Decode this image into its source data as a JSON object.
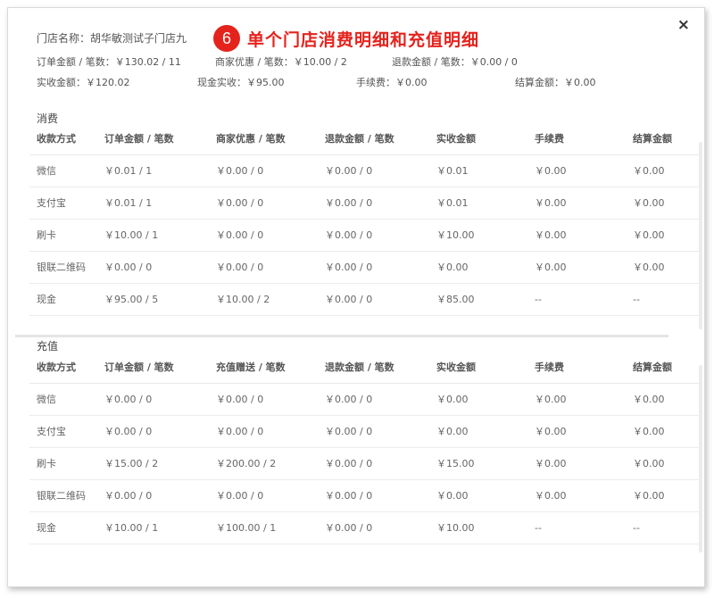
{
  "dialog": {
    "close_label": "×",
    "store_name": "门店名称：胡华敏测试子门店九",
    "banner_num": "6",
    "banner_text": "单个门店消费明细和充值明细"
  },
  "summary": {
    "order": "订单金额 / 笔数：￥130.02 / 11",
    "merchant_discount": "商家优惠 / 笔数：￥10.00 / 2",
    "refund": "退款金额 / 笔数：￥0.00 / 0",
    "received": "实收金额：￥120.02",
    "cash_received": "现金实收：￥95.00",
    "fee": "手续费：￥0.00",
    "settlement": "结算金额：￥0.00"
  },
  "consume": {
    "title": "消费",
    "headers": [
      "收款方式",
      "订单金额 / 笔数",
      "商家优惠 / 笔数",
      "退款金额 / 笔数",
      "实收金额",
      "手续费",
      "结算金额"
    ],
    "rows": [
      [
        "微信",
        "￥0.01 / 1",
        "￥0.00 / 0",
        "￥0.00 / 0",
        "￥0.01",
        "￥0.00",
        "￥0.00"
      ],
      [
        "支付宝",
        "￥0.01 / 1",
        "￥0.00 / 0",
        "￥0.00 / 0",
        "￥0.01",
        "￥0.00",
        "￥0.00"
      ],
      [
        "刷卡",
        "￥10.00 / 1",
        "￥0.00 / 0",
        "￥0.00 / 0",
        "￥10.00",
        "￥0.00",
        "￥0.00"
      ],
      [
        "银联二维码",
        "￥0.00 / 0",
        "￥0.00 / 0",
        "￥0.00 / 0",
        "￥0.00",
        "￥0.00",
        "￥0.00"
      ],
      [
        "现金",
        "￥95.00 / 5",
        "￥10.00 / 2",
        "￥0.00 / 0",
        "￥85.00",
        "--",
        "--"
      ]
    ]
  },
  "recharge": {
    "title": "充值",
    "headers": [
      "收款方式",
      "订单金额 / 笔数",
      "充值赠送 / 笔数",
      "退款金额 / 笔数",
      "实收金额",
      "手续费",
      "结算金额"
    ],
    "rows": [
      [
        "微信",
        "￥0.00 / 0",
        "￥0.00 / 0",
        "￥0.00 / 0",
        "￥0.00",
        "￥0.00",
        "￥0.00"
      ],
      [
        "支付宝",
        "￥0.00 / 0",
        "￥0.00 / 0",
        "￥0.00 / 0",
        "￥0.00",
        "￥0.00",
        "￥0.00"
      ],
      [
        "刷卡",
        "￥15.00 / 2",
        "￥200.00 / 2",
        "￥0.00 / 0",
        "￥15.00",
        "￥0.00",
        "￥0.00"
      ],
      [
        "银联二维码",
        "￥0.00 / 0",
        "￥0.00 / 0",
        "￥0.00 / 0",
        "￥0.00",
        "￥0.00",
        "￥0.00"
      ],
      [
        "现金",
        "￥10.00 / 1",
        "￥100.00 / 1",
        "￥0.00 / 0",
        "￥10.00",
        "--",
        "--"
      ]
    ]
  },
  "colors": {
    "accent_red": "#e4231d",
    "text": "#555555",
    "border": "#ececec"
  }
}
